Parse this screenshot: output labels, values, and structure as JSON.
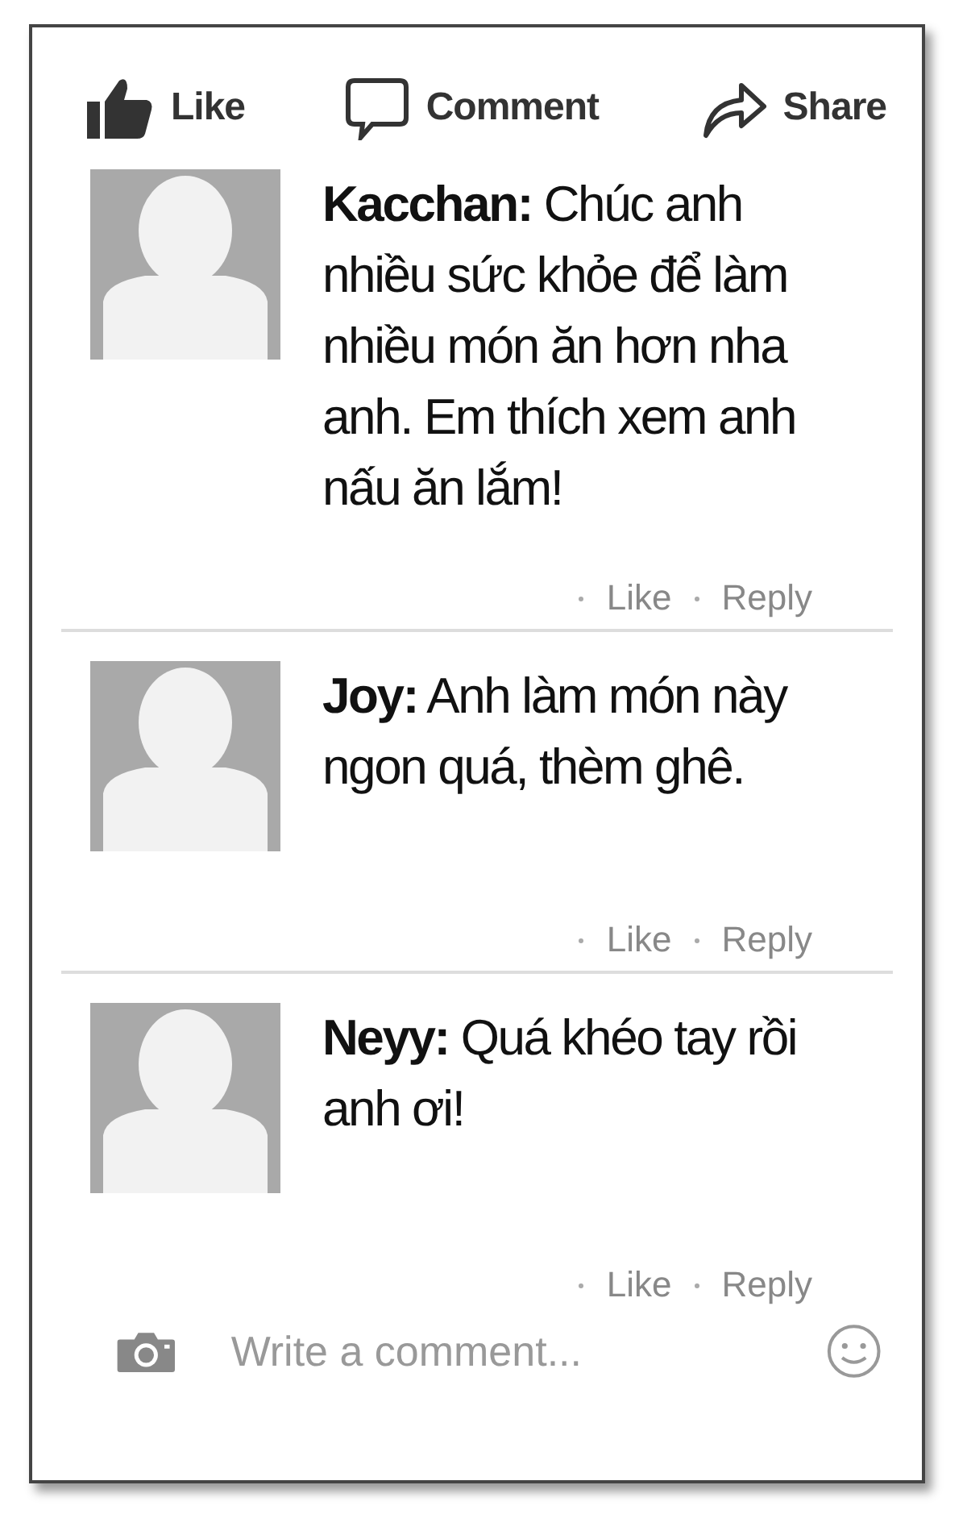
{
  "actions": [
    {
      "kind": "like",
      "label": "Like"
    },
    {
      "kind": "comment",
      "label": "Comment"
    },
    {
      "kind": "share",
      "label": "Share"
    }
  ],
  "comments": [
    {
      "text": "**Kacchan:** Chúc anh nhiều sức khỏe để làm nhiều món ăn hơn nha anh. Em thích xem anh nấu ăn lắm!",
      "like": "Like",
      "reply": "Reply"
    },
    {
      "text": "**Joy:** Anh làm món này ngon quá, thèm ghê.",
      "like": "Like",
      "reply": "Reply"
    },
    {
      "text": "**Neyy:** Quá khéo tay rồi anh ơi!",
      "like": "Like",
      "reply": "Reply"
    }
  ],
  "composer": {
    "placeholder": "Write a comment..."
  }
}
